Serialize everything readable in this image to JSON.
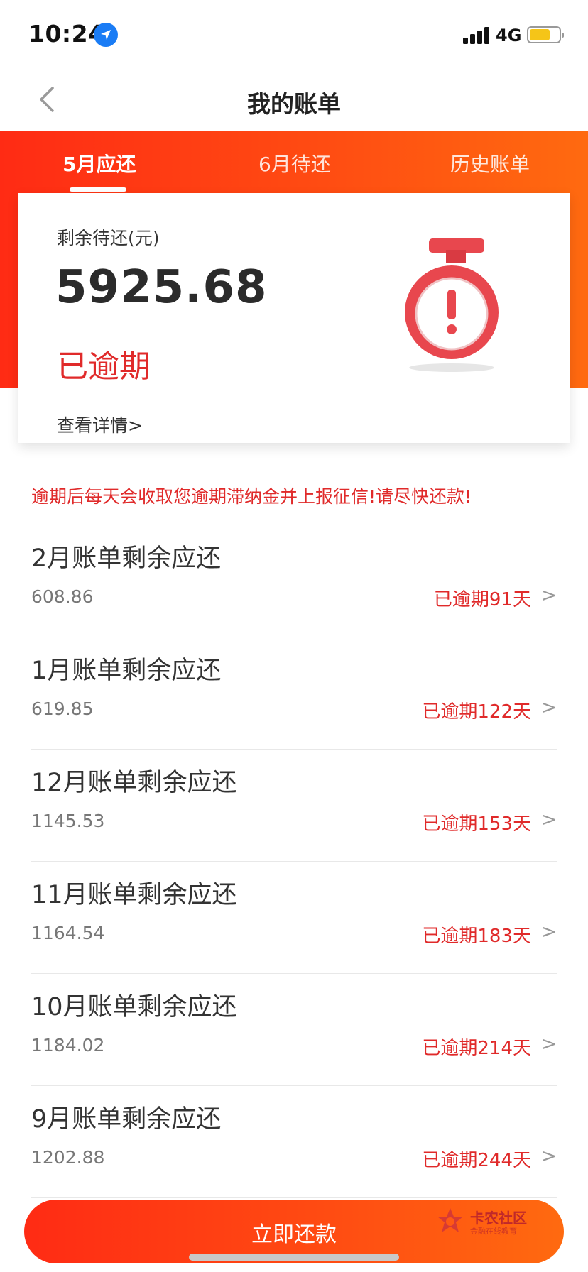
{
  "status_bar": {
    "time": "10:24",
    "network": "4G",
    "location_icon": "location-arrow-icon",
    "signal_icon": "signal-bars-icon",
    "battery_icon": "battery-icon",
    "battery_color": "#f5c518"
  },
  "nav": {
    "title": "我的账单",
    "back_icon": "chevron-left-icon"
  },
  "tabs": [
    {
      "label": "5月应还",
      "active": true
    },
    {
      "label": "6月待还",
      "active": false
    },
    {
      "label": "历史账单",
      "active": false
    }
  ],
  "summary": {
    "label": "剩余待还(元)",
    "amount": "5925.68",
    "status": "已逾期",
    "details_link": "查看详情>",
    "icon": "alarm-clock-warning-icon"
  },
  "warning": "逾期后每天会收取您逾期滞纳金并上报征信!请尽快还款!",
  "bills": [
    {
      "title": "2月账单剩余应还",
      "amount": "608.86",
      "overdue": "已逾期91天",
      "chevron": ">"
    },
    {
      "title": "1月账单剩余应还",
      "amount": "619.85",
      "overdue": "已逾期122天",
      "chevron": ">"
    },
    {
      "title": "12月账单剩余应还",
      "amount": "1145.53",
      "overdue": "已逾期153天",
      "chevron": ">"
    },
    {
      "title": "11月账单剩余应还",
      "amount": "1164.54",
      "overdue": "已逾期183天",
      "chevron": ">"
    },
    {
      "title": "10月账单剩余应还",
      "amount": "1184.02",
      "overdue": "已逾期214天",
      "chevron": ">"
    },
    {
      "title": "9月账单剩余应还",
      "amount": "1202.88",
      "overdue": "已逾期244天",
      "chevron": ">"
    }
  ],
  "pay_button": {
    "label": "立即还款"
  },
  "watermark": {
    "name": "卡农社区",
    "sub": "金融在线教育"
  },
  "colors": {
    "accent_red": "#ff2b14",
    "accent_orange": "#ff6a10",
    "overdue_text": "#e02a2a"
  }
}
